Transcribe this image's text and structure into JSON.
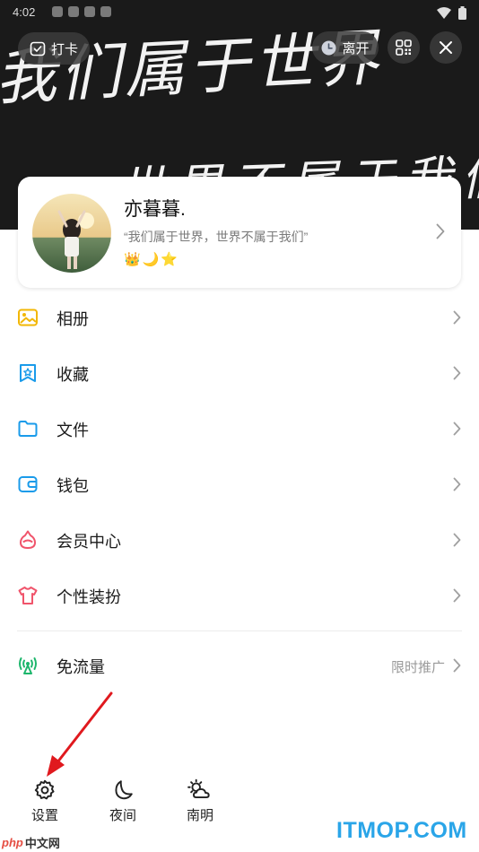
{
  "status_bar": {
    "time": "4:02"
  },
  "header": {
    "background_text_line1": "我们属于世界",
    "background_text_line2": "世界不属于我们",
    "checkin_label": "打卡",
    "leave_label": "离开"
  },
  "profile": {
    "nickname": "亦暮暮.",
    "signature": "“我们属于世界，世界不属于我们”",
    "badges": [
      "👑",
      "🌙",
      "⭐"
    ]
  },
  "menu": [
    {
      "label": "相册",
      "icon": "photo-album-icon",
      "color": "#f2b705"
    },
    {
      "label": "收藏",
      "icon": "favorites-icon",
      "color": "#1a9bea"
    },
    {
      "label": "文件",
      "icon": "folder-icon",
      "color": "#1a9bea"
    },
    {
      "label": "钱包",
      "icon": "wallet-icon",
      "color": "#1a9bea"
    },
    {
      "label": "会员中心",
      "icon": "vip-icon",
      "color": "#f0546b"
    },
    {
      "label": "个性装扮",
      "icon": "tshirt-icon",
      "color": "#f0546b"
    }
  ],
  "free_data": {
    "label": "免流量",
    "icon": "signal-icon",
    "color": "#1db66c",
    "promo": "限时推广"
  },
  "bottom_tools": [
    {
      "label": "设置",
      "icon": "settings-icon"
    },
    {
      "label": "夜间",
      "icon": "moon-icon"
    },
    {
      "label": "南明",
      "icon": "weather-icon"
    }
  ],
  "watermarks": {
    "right": "ITMOP.COM",
    "left_brand": "php",
    "left_text": "中文网"
  },
  "colors": {
    "accent_blue": "#1a9bea",
    "header_bg": "#1a1a1a",
    "arrow_red": "#e0191e"
  }
}
